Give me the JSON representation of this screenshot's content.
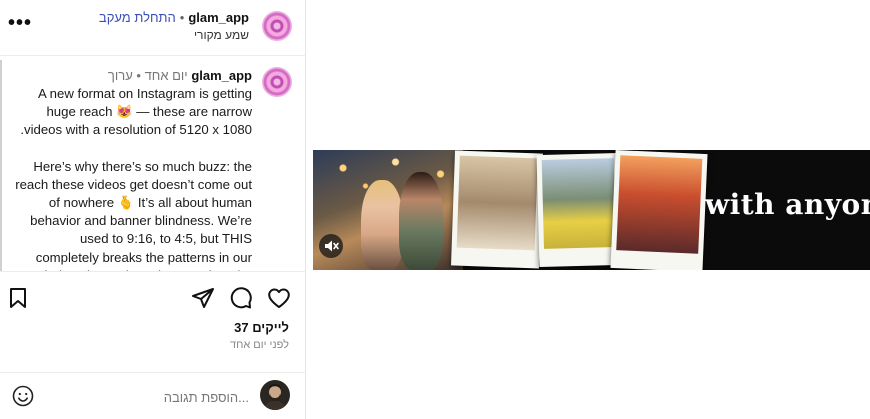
{
  "header": {
    "username": "glam_app",
    "separator": "•",
    "follow_label": "התחלת מעקב",
    "subtitle": "שמע מקורי",
    "more_icon": "more-horizontal-icon"
  },
  "caption": {
    "username": "glam_app",
    "edited_label": "ערוך",
    "separator": "•",
    "time_ago": "יום אחד",
    "paragraphs": [
      "A new format on Instagram is getting huge reach 😻 — these are narrow .videos with a resolution of 5120 x 1080",
      "Here’s why there’s so much buzz: the reach these videos get doesn’t come out of nowhere 🫰 It’s all about human behavior and banner blindness. We’re used to 9:16, to 4:5, but THIS completely breaks the patterns in our minds. It instantly grabs attention, the"
    ]
  },
  "actions": {
    "like_icon": "heart-icon",
    "comment_icon": "comment-icon",
    "share_icon": "send-icon",
    "save_icon": "bookmark-icon"
  },
  "stats": {
    "likes": "37 לייקים",
    "posted": "לפני יום אחד"
  },
  "comment": {
    "placeholder": "...הוספת תגובה",
    "emoji_icon": "smiley-icon"
  },
  "video": {
    "overlay_text": "with anyone",
    "mute_icon": "muted-speaker-icon"
  },
  "colors": {
    "follow": "#3b4fb8",
    "video_bg": "#0b0b0b",
    "muted_text": "#777777"
  }
}
